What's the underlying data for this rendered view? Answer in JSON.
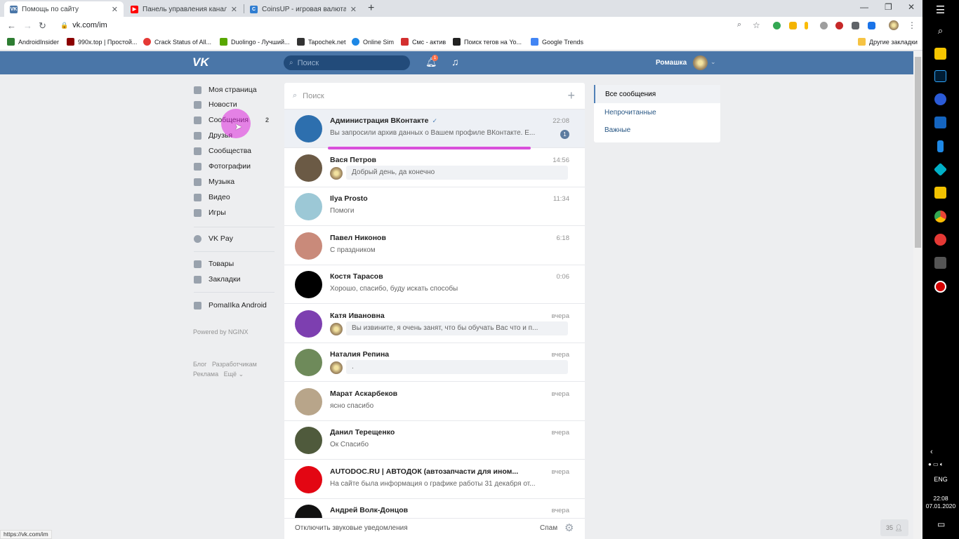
{
  "browser": {
    "tabs": [
      {
        "title": "Помощь по сайту",
        "favicon": "vk-icon",
        "favicon_color": "#4a76a8",
        "active": true
      },
      {
        "title": "Панель управления каналом -",
        "favicon": "youtube-icon",
        "favicon_color": "#ff0000",
        "active": false
      },
      {
        "title": "CoinsUP - игровая валюта, про",
        "favicon": "coinsup-icon",
        "favicon_color": "#2f7dd1",
        "active": false
      }
    ],
    "url": "vk.com/im",
    "bookmarks": [
      {
        "label": "AndroidInsider",
        "color": "#2e7d32"
      },
      {
        "label": "990x.top | Простой...",
        "color": "#8b0000"
      },
      {
        "label": "Crack Status of All...",
        "color": "#e53935"
      },
      {
        "label": "Duolingo - Лучший...",
        "color": "#58a700"
      },
      {
        "label": "Tapochek.net",
        "color": "#333333"
      },
      {
        "label": "Online Sim",
        "color": "#1e88e5"
      },
      {
        "label": "Смс - актив",
        "color": "#d32f2f"
      },
      {
        "label": "Поиск тегов на Yo...",
        "color": "#222222"
      },
      {
        "label": "Google Trends",
        "color": "#4285f4"
      }
    ],
    "other_bookmarks": "Другие закладки",
    "status_url": "https://vk.com/im"
  },
  "vk_header": {
    "search_placeholder": "Поиск",
    "notification_count": "1",
    "user_name": "Ромашка"
  },
  "left_nav": {
    "items": [
      {
        "label": "Моя страница",
        "icon": "home-icon"
      },
      {
        "label": "Новости",
        "icon": "news-icon"
      },
      {
        "label": "Сообщения",
        "icon": "messages-icon",
        "count": "2"
      },
      {
        "label": "Друзья",
        "icon": "friends-icon"
      },
      {
        "label": "Сообщества",
        "icon": "groups-icon"
      },
      {
        "label": "Фотографии",
        "icon": "photo-icon"
      },
      {
        "label": "Музыка",
        "icon": "music-icon"
      },
      {
        "label": "Видео",
        "icon": "video-icon"
      },
      {
        "label": "Игры",
        "icon": "games-icon"
      },
      {
        "label": "VK Pay",
        "icon": "vkpay-icon"
      },
      {
        "label": "Товары",
        "icon": "market-icon"
      },
      {
        "label": "Закладки",
        "icon": "bookmark-icon"
      },
      {
        "label": "PomaIIka Android",
        "icon": "group-icon"
      }
    ],
    "powered": "Powered by NGINX",
    "footer_links": [
      "Блог",
      "Разработчикам",
      "Реклама",
      "Ещё"
    ]
  },
  "im": {
    "search_placeholder": "Поиск",
    "conversations": [
      {
        "name": "Администрация ВКонтакте",
        "verified": "✓",
        "time": "22:08",
        "message": "Вы запросили архив данных о Вашем профиле ВКонтакте. Е...",
        "unread": "1",
        "avatar_color": "#2d6fae",
        "selected": true,
        "own_reply": false
      },
      {
        "name": "Вася Петров",
        "time": "14:56",
        "message": "Добрый день, да конечно",
        "avatar_color": "#6b5a45",
        "own_reply": true
      },
      {
        "name": "Ilya Prosto",
        "time": "11:34",
        "message": "Помоги",
        "avatar_color": "#9cc8d6",
        "own_reply": false
      },
      {
        "name": "Павел Никонов",
        "time": "6:18",
        "message": "С праздником",
        "avatar_color": "#c98a7a",
        "own_reply": false
      },
      {
        "name": "Костя Тарасов",
        "time": "0:06",
        "message": "Хорошо, спасибо, буду искать способы",
        "avatar_color": "#000000",
        "own_reply": false
      },
      {
        "name": "Катя Ивановна",
        "time": "вчера",
        "message": "Вы извините, я очень занят, что бы обучать Вас что и п...",
        "avatar_color": "#7d3fb0",
        "own_reply": true
      },
      {
        "name": "Наталия Репина",
        "time": "вчера",
        "message": ".",
        "avatar_color": "#6e8a5a",
        "own_reply": true
      },
      {
        "name": "Марат Аскарбеков",
        "time": "вчера",
        "message": "ясно спасибо",
        "avatar_color": "#b8a58a",
        "own_reply": false
      },
      {
        "name": "Данил Терещенко",
        "time": "вчера",
        "message": "Ок Спасибо",
        "avatar_color": "#4f5a3c",
        "own_reply": false
      },
      {
        "name": "AUTODOC.RU | АВТОДОК (автозапчасти для ином...",
        "time": "вчера",
        "message": "На сайте была информация о графике работы 31 декабря от...",
        "avatar_color": "#e30613",
        "own_reply": false
      },
      {
        "name": "Андрей Волк-Донцов",
        "time": "вчера",
        "message": "",
        "avatar_color": "#111111",
        "own_reply": false
      }
    ],
    "footer_mute": "Отключить звуковые уведомления",
    "footer_spam": "Спам"
  },
  "filters": [
    "Все сообщения",
    "Непрочитанные",
    "Важные"
  ],
  "chat_count": "35",
  "taskbar": {
    "lang": "ENG",
    "time": "22:08",
    "date": "07.01.2020"
  },
  "colors": {
    "vk_blue": "#4a76a8",
    "highlight_pink": "#d94fdb"
  }
}
